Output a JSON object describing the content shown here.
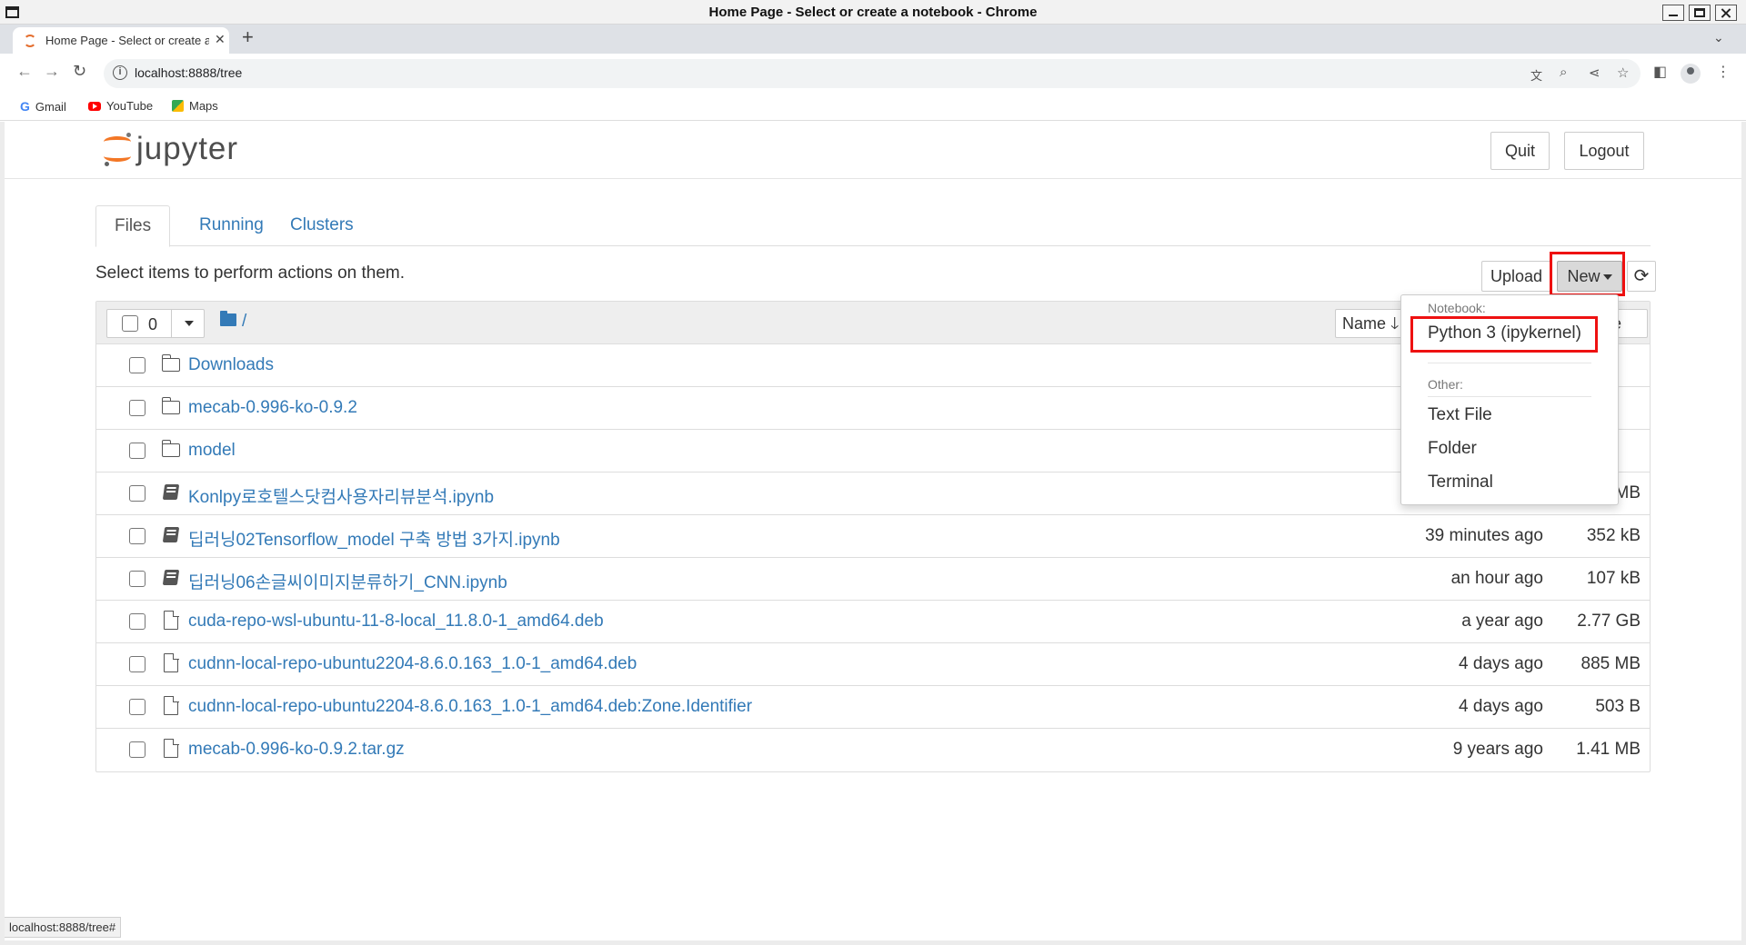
{
  "window": {
    "title": "Home Page - Select or create a notebook - Chrome"
  },
  "browser": {
    "tab_title": "Home Page - Select or create a notebook",
    "url": "localhost:8888/tree",
    "bookmarks": [
      {
        "label": "Gmail",
        "icon": "google-icon"
      },
      {
        "label": "YouTube",
        "icon": "youtube-icon"
      },
      {
        "label": "Maps",
        "icon": "maps-icon"
      }
    ]
  },
  "header": {
    "logo_text": "jupyter",
    "quit_label": "Quit",
    "logout_label": "Logout"
  },
  "tabs": [
    {
      "label": "Files",
      "active": true
    },
    {
      "label": "Running",
      "active": false
    },
    {
      "label": "Clusters",
      "active": false
    }
  ],
  "actions": {
    "message": "Select items to perform actions on them.",
    "upload_label": "Upload",
    "new_label": "New"
  },
  "list_header": {
    "selected_count": "0",
    "breadcrumb": "/",
    "name_sort_label": "Name",
    "size_sort_label_partial": "e"
  },
  "files": [
    {
      "type": "folder",
      "name": "Downloads",
      "modified": "",
      "size": ""
    },
    {
      "type": "folder",
      "name": "mecab-0.996-ko-0.9.2",
      "modified": "",
      "size": ""
    },
    {
      "type": "folder",
      "name": "model",
      "modified": "",
      "size": ""
    },
    {
      "type": "notebook",
      "name": "Konlpy로호텔스닷컴사용자리뷰분석.ipynb",
      "modified": "",
      "size": "MB"
    },
    {
      "type": "notebook",
      "name": "딥러닝02Tensorflow_model 구축 방법 3가지.ipynb",
      "modified": "39 minutes ago",
      "size": "352 kB"
    },
    {
      "type": "notebook",
      "name": "딥러닝06손글씨이미지분류하기_CNN.ipynb",
      "modified": "an hour ago",
      "size": "107 kB"
    },
    {
      "type": "file",
      "name": "cuda-repo-wsl-ubuntu-11-8-local_11.8.0-1_amd64.deb",
      "modified": "a year ago",
      "size": "2.77 GB"
    },
    {
      "type": "file",
      "name": "cudnn-local-repo-ubuntu2204-8.6.0.163_1.0-1_amd64.deb",
      "modified": "4 days ago",
      "size": "885 MB"
    },
    {
      "type": "file",
      "name": "cudnn-local-repo-ubuntu2204-8.6.0.163_1.0-1_amd64.deb:Zone.Identifier",
      "modified": "4 days ago",
      "size": "503 B"
    },
    {
      "type": "file",
      "name": "mecab-0.996-ko-0.9.2.tar.gz",
      "modified": "9 years ago",
      "size": "1.41 MB"
    }
  ],
  "new_menu": {
    "notebook_header": "Notebook:",
    "python_kernel": "Python 3 (ipykernel)",
    "other_header": "Other:",
    "text_file": "Text File",
    "folder": "Folder",
    "terminal": "Terminal"
  },
  "status_bar": {
    "text": "localhost:8888/tree#"
  },
  "colors": {
    "link": "#337ab7",
    "highlight": "#e11111",
    "jupyter_orange": "#f37726"
  }
}
